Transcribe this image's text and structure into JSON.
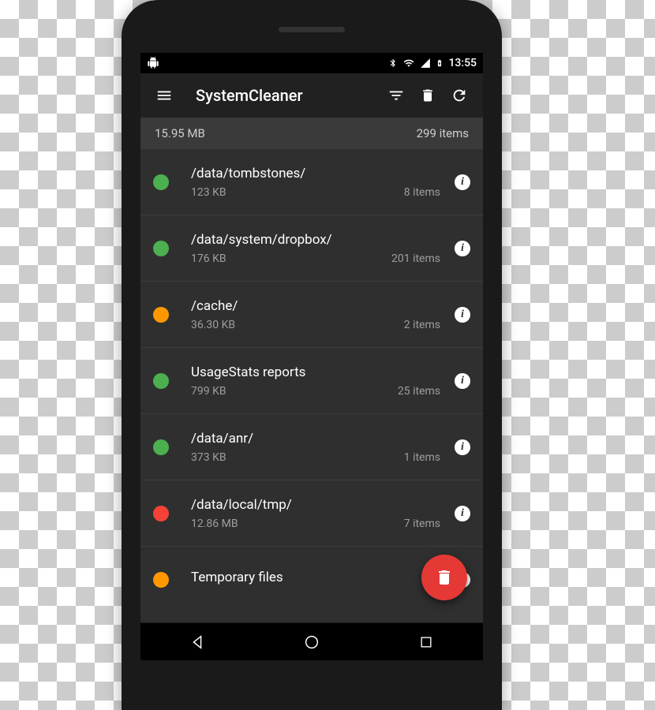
{
  "status": {
    "time": "13:55"
  },
  "appbar": {
    "title": "SystemCleaner"
  },
  "summary": {
    "size": "15.95 MB",
    "items": "299 items"
  },
  "list": [
    {
      "color": "green",
      "title": "/data/tombstones/",
      "size": "123 KB",
      "items": "8 items"
    },
    {
      "color": "green",
      "title": "/data/system/dropbox/",
      "size": "176 KB",
      "items": "201 items"
    },
    {
      "color": "orange",
      "title": "/cache/",
      "size": "36.30 KB",
      "items": "2 items"
    },
    {
      "color": "green",
      "title": "UsageStats reports",
      "size": "799 KB",
      "items": "25 items"
    },
    {
      "color": "green",
      "title": "/data/anr/",
      "size": "373 KB",
      "items": "1 items"
    },
    {
      "color": "red",
      "title": "/data/local/tmp/",
      "size": "12.86 MB",
      "items": "7 items"
    },
    {
      "color": "orange",
      "title": "Temporary files",
      "size": "",
      "items": ""
    }
  ]
}
